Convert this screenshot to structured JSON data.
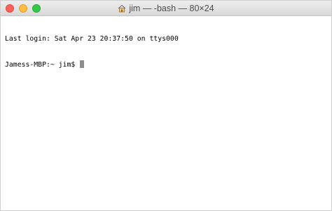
{
  "window": {
    "title": "jim — -bash — 80×24",
    "icon": "home-folder-icon"
  },
  "terminal": {
    "lines": [
      "Last login: Sat Apr 23 20:37:50 on ttys000"
    ],
    "prompt": "Jamess-MBP:~ jim$ "
  },
  "colors": {
    "close": "#fc605c",
    "minimize": "#fdbc40",
    "maximize": "#34c84a",
    "cursor": "#8d8d8d",
    "background": "#ffffff"
  }
}
